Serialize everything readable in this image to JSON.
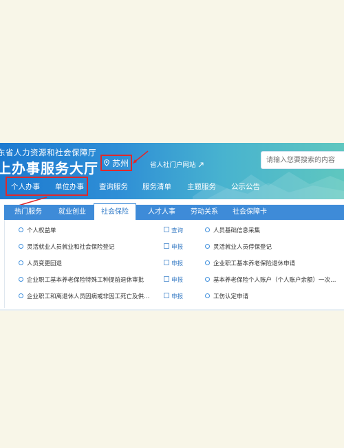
{
  "header": {
    "org_name": "东省人力资源和社会保障厅",
    "hall_title": "上办事服务大厅",
    "city": "苏州",
    "portal_link": "省人社门户网站",
    "search_placeholder": "请输入您要搜索的内容"
  },
  "nav": [
    "个人办事",
    "单位办事",
    "查询服务",
    "服务清单",
    "主题服务",
    "公示公告"
  ],
  "tabs": [
    "热门服务",
    "就业创业",
    "社会保险",
    "人才人事",
    "劳动关系",
    "社会保障卡"
  ],
  "active_tab": "社会保险",
  "services_left": [
    {
      "label": "个人权益单",
      "action": "查询"
    },
    {
      "label": "灵活就业人员就业和社会保险登记",
      "action": "申报"
    },
    {
      "label": "人员变更回退",
      "action": "申报"
    },
    {
      "label": "企业职工基本养老保险特殊工种提前退休审批",
      "action": "申报"
    },
    {
      "label": "企业职工和离退休人员因病或非因工死亡及供…",
      "action": "申报"
    }
  ],
  "services_right": [
    {
      "label": "人员基础信息采集"
    },
    {
      "label": "灵活就业人员停保登记"
    },
    {
      "label": "企业职工基本养老保险退休申请"
    },
    {
      "label": "基本养老保险个人账户（个人账户余额）一次…"
    },
    {
      "label": "工伤认定申请"
    }
  ],
  "colors": {
    "header_start": "#1d7ad0",
    "header_end": "#5fc7bf",
    "tab_bar": "#3e8bd8",
    "highlight_box": "#e0282a",
    "action_link": "#3d7fc6",
    "page_background": "#f8f6e8"
  },
  "icons": {
    "city": "location-pin-icon",
    "portal": "external-link-icon",
    "bullet": "ring-bullet-icon",
    "action": "form-icon"
  }
}
